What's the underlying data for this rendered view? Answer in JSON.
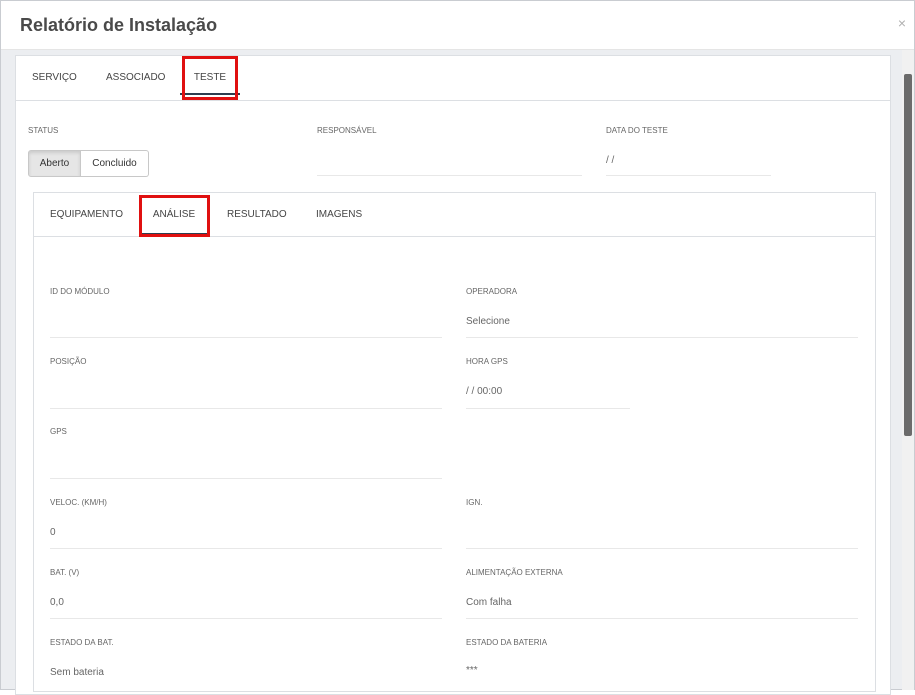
{
  "modal": {
    "title": "Relatório de Instalação",
    "close_label": "×"
  },
  "top_tabs": [
    {
      "label": "SERVIÇO"
    },
    {
      "label": "ASSOCIADO"
    },
    {
      "label": "TESTE"
    }
  ],
  "header_fields": {
    "status_label": "STATUS",
    "status_options": [
      "Aberto",
      "Concluido"
    ],
    "status_selected": "Aberto",
    "responsavel_label": "RESPONSÁVEL",
    "responsavel_value": "",
    "data_label": "DATA DO TESTE",
    "data_value": "/ /"
  },
  "inner_tabs": [
    {
      "label": "EQUIPAMENTO"
    },
    {
      "label": "ANÁLISE"
    },
    {
      "label": "RESULTADO"
    },
    {
      "label": "IMAGENS"
    }
  ],
  "fields": {
    "id_modulo": {
      "label": "ID DO MÓDULO",
      "value": ""
    },
    "operadora": {
      "label": "OPERADORA",
      "value": "Selecione"
    },
    "posicao": {
      "label": "POSIÇÃO",
      "value": ""
    },
    "hora_gps": {
      "label": "HORA GPS",
      "value": "/ / 00:00"
    },
    "gps": {
      "label": "GPS",
      "value": ""
    },
    "veloc": {
      "label": "VELOC. (KM/H)",
      "value": "0"
    },
    "ign": {
      "label": "IGN.",
      "value": ""
    },
    "bat": {
      "label": "BAT. (V)",
      "value": "0,0"
    },
    "alimentacao": {
      "label": "ALIMENTAÇÃO EXTERNA",
      "value": "Com falha"
    },
    "estado_bat": {
      "label": "ESTADO DA BAT.",
      "value": "Sem bateria"
    },
    "estado_bateria": {
      "label": "ESTADO DA BATERIA",
      "value": "***"
    }
  },
  "colors": {
    "highlight": "#e01010",
    "active_underline": "#2d3e50"
  }
}
